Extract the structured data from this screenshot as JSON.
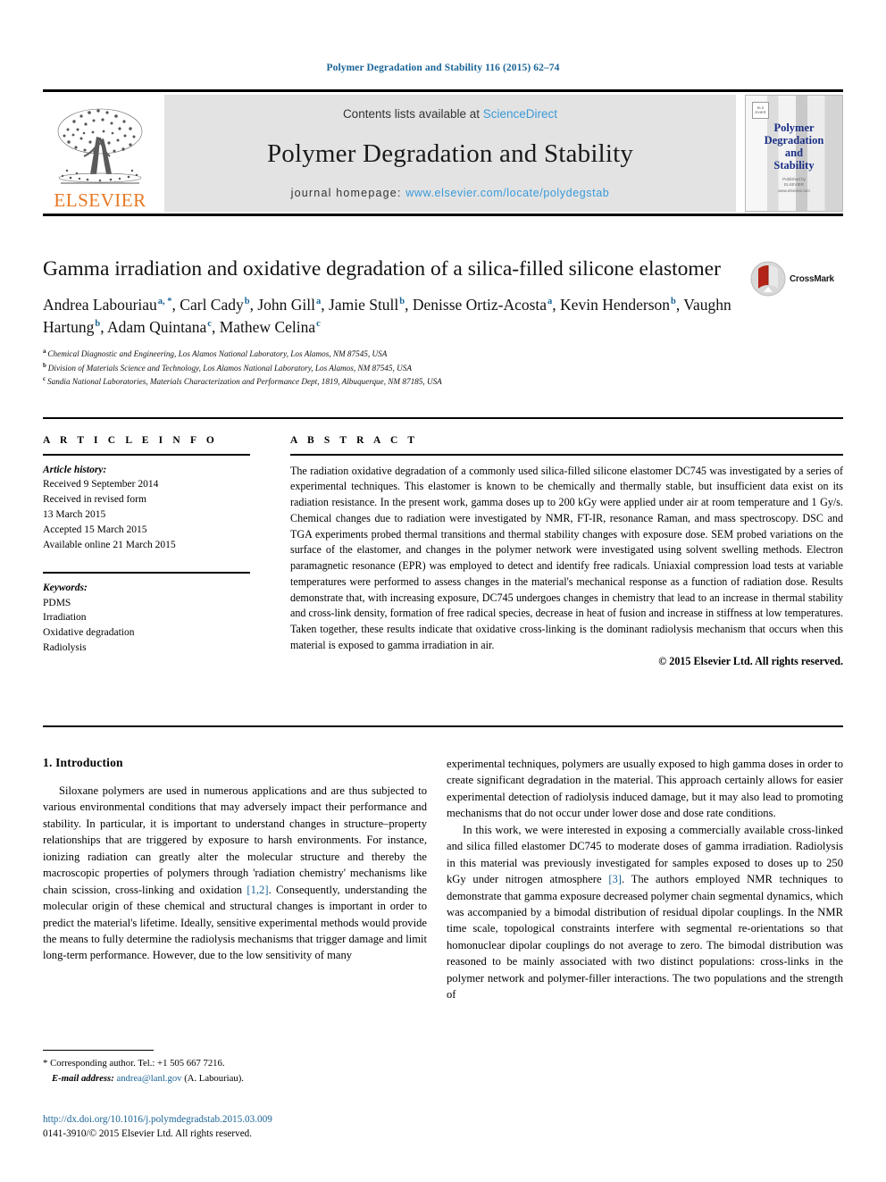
{
  "running_head": "Polymer Degradation and Stability 116 (2015) 62–74",
  "masthead": {
    "contents_prefix": "Contents lists available at ",
    "sciencedirect": "ScienceDirect",
    "journal_name": "Polymer Degradation and Stability",
    "homepage_label": "journal homepage: ",
    "homepage_url": "www.elsevier.com/locate/polydegstab",
    "publisher_logo_text": "ELSEVIER",
    "cover_title": "Polymer\nDegradation\nand\nStability",
    "cover_footer": "Published by\nELSEVIER\nwww.elsevier.com/locate/polydegstab"
  },
  "article": {
    "title": "Gamma irradiation and oxidative degradation of a silica-filled silicone elastomer",
    "crossmark_label": "CrossMark",
    "authors": [
      {
        "name": "Andrea Labouriau",
        "marks": "a, *",
        "sep": ", "
      },
      {
        "name": "Carl Cady",
        "marks": "b",
        "sep": ", "
      },
      {
        "name": "John Gill",
        "marks": "a",
        "sep": ", "
      },
      {
        "name": "Jamie Stull",
        "marks": "b",
        "sep": ", "
      },
      {
        "name": "Denisse Ortiz-Acosta",
        "marks": "a",
        "sep": ", "
      },
      {
        "name": "Kevin Henderson",
        "marks": "b",
        "sep": ", "
      },
      {
        "name": "Vaughn Hartung",
        "marks": "b",
        "sep": ", "
      },
      {
        "name": "Adam Quintana",
        "marks": "c",
        "sep": ", "
      },
      {
        "name": "Mathew Celina",
        "marks": "c",
        "sep": ""
      }
    ],
    "affiliations": [
      {
        "mark": "a",
        "text": "Chemical Diagnostic and Engineering, Los Alamos National Laboratory, Los Alamos, NM 87545, USA"
      },
      {
        "mark": "b",
        "text": "Division of Materials Science and Technology, Los Alamos National Laboratory, Los Alamos, NM 87545, USA"
      },
      {
        "mark": "c",
        "text": "Sandia National Laboratories, Materials Characterization and Performance Dept, 1819, Albuquerque, NM 87185, USA"
      }
    ]
  },
  "article_info": {
    "heading": "A R T I C L E  I N F O",
    "history_label": "Article history:",
    "history_lines": [
      "Received 9 September 2014",
      "Received in revised form",
      "13 March 2015",
      "Accepted 15 March 2015",
      "Available online 21 March 2015"
    ],
    "keywords_label": "Keywords:",
    "keywords": [
      "PDMS",
      "Irradiation",
      "Oxidative degradation",
      "Radiolysis"
    ]
  },
  "abstract": {
    "heading": "A B S T R A C T",
    "text": "The radiation oxidative degradation of a commonly used silica-filled silicone elastomer DC745 was investigated by a series of experimental techniques. This elastomer is known to be chemically and thermally stable, but insufficient data exist on its radiation resistance. In the present work, gamma doses up to 200 kGy were applied under air at room temperature and 1 Gy/s. Chemical changes due to radiation were investigated by NMR, FT-IR, resonance Raman, and mass spectroscopy. DSC and TGA experiments probed thermal transitions and thermal stability changes with exposure dose. SEM probed variations on the surface of the elastomer, and changes in the polymer network were investigated using solvent swelling methods. Electron paramagnetic resonance (EPR) was employed to detect and identify free radicals. Uniaxial compression load tests at variable temperatures were performed to assess changes in the material's mechanical response as a function of radiation dose. Results demonstrate that, with increasing exposure, DC745 undergoes changes in chemistry that lead to an increase in thermal stability and cross-link density, formation of free radical species, decrease in heat of fusion and increase in stiffness at low temperatures. Taken together, these results indicate that oxidative cross-linking is the dominant radiolysis mechanism that occurs when this material is exposed to gamma irradiation in air.",
    "copyright": "© 2015 Elsevier Ltd. All rights reserved."
  },
  "introduction": {
    "heading": "1. Introduction",
    "left_p1_a": "Siloxane polymers are used in numerous applications and are thus subjected to various environmental conditions that may adversely impact their performance and stability. In particular, it is important to understand changes in structure–property relationships that are triggered by exposure to harsh environments. For instance, ionizing radiation can greatly alter the molecular structure and thereby the macroscopic properties of polymers through 'radiation chemistry' mechanisms like chain scission, cross-linking and oxidation ",
    "left_p1_cite": "[1,2]",
    "left_p1_b": ". Consequently, understanding the molecular origin of these chemical and structural changes is important in order to predict the material's lifetime. Ideally, sensitive experimental methods would provide the means to fully determine the radiolysis mechanisms that trigger damage and limit long-term performance. However, due to the low sensitivity of many",
    "right_p1": "experimental techniques, polymers are usually exposed to high gamma doses in order to create significant degradation in the material. This approach certainly allows for easier experimental detection of radiolysis induced damage, but it may also lead to promoting mechanisms that do not occur under lower dose and dose rate conditions.",
    "right_p2_a": "In this work, we were interested in exposing a commercially available cross-linked and silica filled elastomer DC745 to moderate doses of gamma irradiation. Radiolysis in this material was previously investigated for samples exposed to doses up to 250 kGy under nitrogen atmosphere ",
    "right_p2_cite": "[3]",
    "right_p2_b": ". The authors employed NMR techniques to demonstrate that gamma exposure decreased polymer chain segmental dynamics, which was accompanied by a bimodal distribution of residual dipolar couplings. In the NMR time scale, topological constraints interfere with segmental re-orientations so that homonuclear dipolar couplings do not average to zero. The bimodal distribution was reasoned to be mainly associated with two distinct populations: cross-links in the polymer network and polymer-filler interactions. The two populations and the strength of"
  },
  "footnote": {
    "star": "*",
    "corresponding": " Corresponding author. Tel.: +1 505 667 7216.",
    "email_label": "E-mail address:",
    "email": "andrea@lanl.gov",
    "email_suffix": " (A. Labouriau)."
  },
  "doi_block": {
    "doi": "http://dx.doi.org/10.1016/j.polymdegradstab.2015.03.009",
    "issn": "0141-3910/© 2015 Elsevier Ltd. All rights reserved."
  },
  "colors": {
    "link_blue": "#1a6496",
    "sciencedirect_blue": "#3a9ad9",
    "elsevier_orange": "#e87722",
    "cover_navy": "#1b2f86",
    "band_gray": "#e3e3e3"
  }
}
